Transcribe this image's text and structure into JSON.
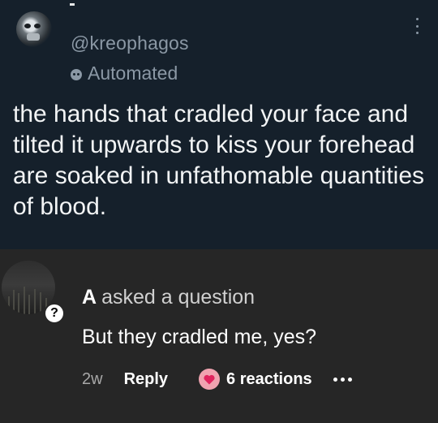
{
  "tweet": {
    "handle": "@kreophagos",
    "label": "Automated",
    "text": "the hands that cradled your face and tilted it upwards to kiss your forehead are soaked in unfathomable quantities of blood.",
    "icons": [
      "avatar",
      "more-icon",
      "bot-icon"
    ]
  },
  "reply": {
    "asker_name": "A",
    "asker_action": "asked a question",
    "badge": "?",
    "question": "But they cradled me, yes?",
    "time": "2w",
    "reply_label": "Reply",
    "reactions_label": "6 reactions",
    "icons": [
      "heart-icon",
      "more-dots-icon"
    ]
  },
  "colors": {
    "tweet_bg": "#15202b",
    "reply_bg": "#262626",
    "muted_text": "#8b98a5",
    "reaction_badge": "#f0a3b0"
  }
}
